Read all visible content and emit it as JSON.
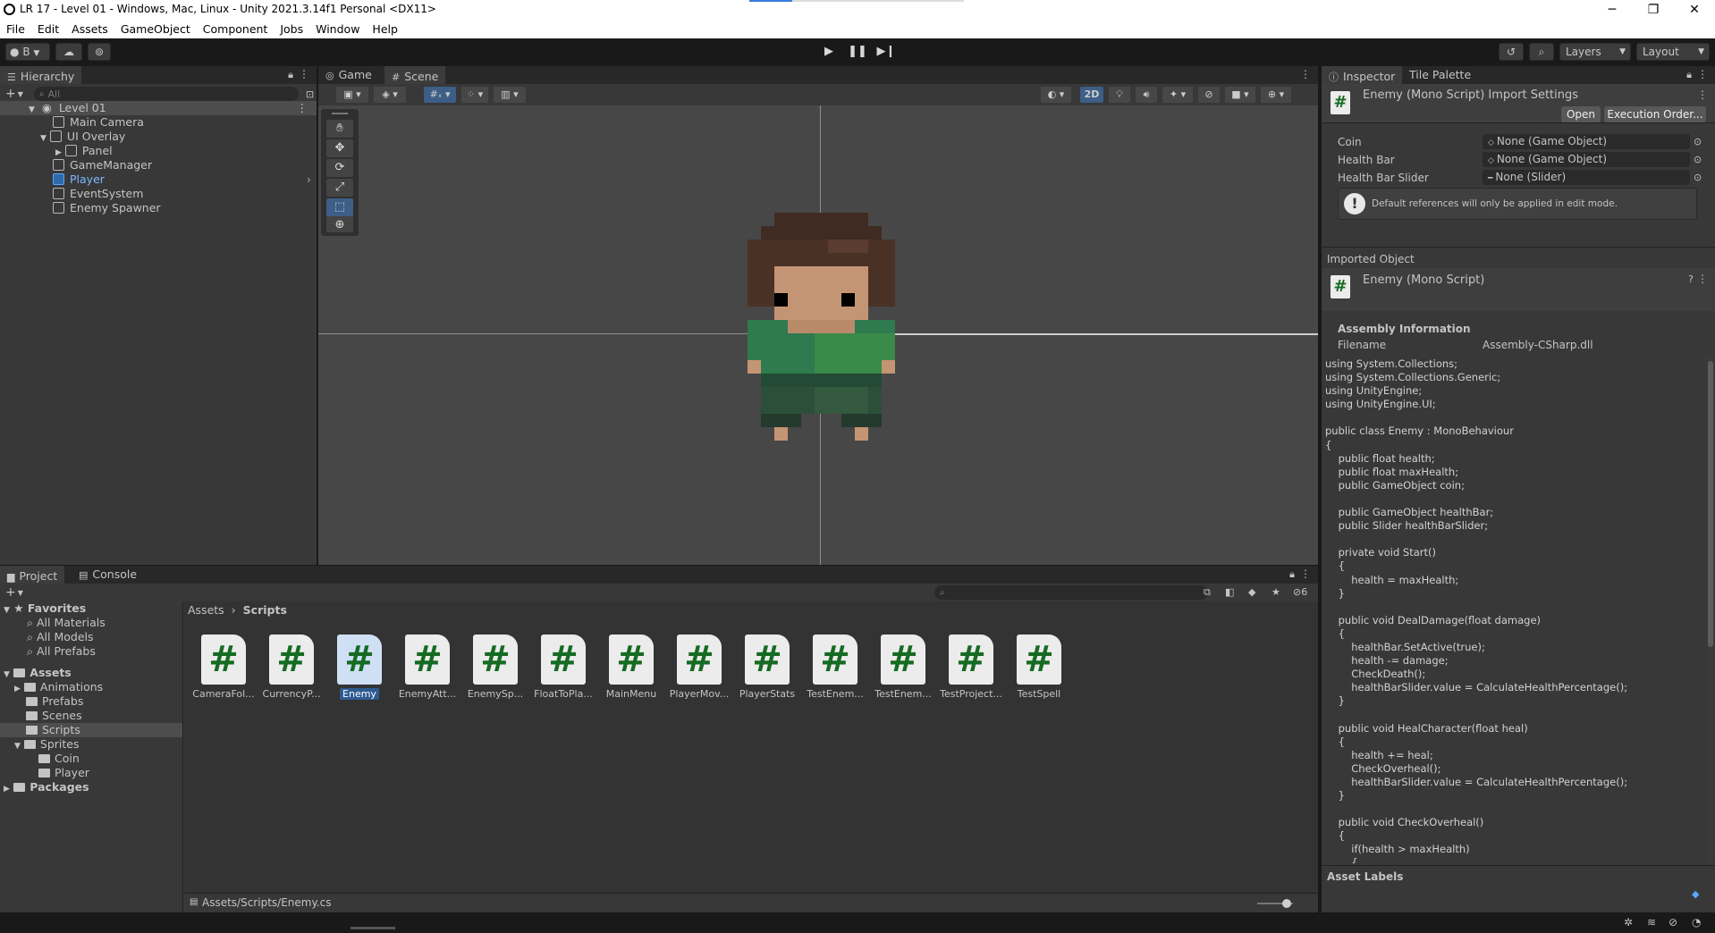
{
  "window": {
    "title": "LR 17 - Level 01 - Windows, Mac, Linux - Unity 2021.3.14f1 Personal <DX11>",
    "controls": [
      "─",
      "❐",
      "✕"
    ]
  },
  "menu": [
    "File",
    "Edit",
    "Assets",
    "GameObject",
    "Component",
    "Jobs",
    "Window",
    "Help"
  ],
  "toolbar": {
    "account_label": "B",
    "layers_label": "Layers",
    "layout_label": "Layout"
  },
  "hierarchy": {
    "tab": "Hierarchy",
    "search_placeholder": "All",
    "items": [
      {
        "label": "Level 01",
        "depth": 0,
        "kind": "scene"
      },
      {
        "label": "Main Camera",
        "depth": 1,
        "kind": "object"
      },
      {
        "label": "UI Overlay",
        "depth": 1,
        "kind": "object"
      },
      {
        "label": "Panel",
        "depth": 2,
        "kind": "object"
      },
      {
        "label": "GameManager",
        "depth": 1,
        "kind": "object"
      },
      {
        "label": "Player",
        "depth": 1,
        "kind": "prefab"
      },
      {
        "label": "EventSystem",
        "depth": 1,
        "kind": "object"
      },
      {
        "label": "Enemy Spawner",
        "depth": 1,
        "kind": "object"
      }
    ]
  },
  "scene": {
    "tabs": [
      "Game",
      "Scene"
    ],
    "mode_2d": "2D"
  },
  "project": {
    "tabs": [
      "Project",
      "Console"
    ],
    "favorites_label": "Favorites",
    "favorites": [
      "All Materials",
      "All Models",
      "All Prefabs"
    ],
    "assets_label": "Assets",
    "folders": [
      "Animations",
      "Prefabs",
      "Scenes",
      "Scripts",
      "Sprites"
    ],
    "sprite_folders": [
      "Coin",
      "Player"
    ],
    "packages_label": "Packages",
    "breadcrumb": [
      "Assets",
      "Scripts"
    ],
    "hidden_count": "6",
    "scripts": [
      "CameraFol...",
      "CurrencyP...",
      "Enemy",
      "EnemyAtt...",
      "EnemySp...",
      "FloatToPla...",
      "MainMenu",
      "PlayerMov...",
      "PlayerStats",
      "TestEnem...",
      "TestEnem...",
      "TestProject...",
      "TestSpell"
    ],
    "selected_path": "Assets/Scripts/Enemy.cs"
  },
  "inspector": {
    "tabs": [
      "Inspector",
      "Tile Palette"
    ],
    "header_title": "Enemy (Mono Script) Import Settings",
    "open_button": "Open",
    "exec_order_button": "Execution Order...",
    "fields": [
      {
        "label": "Coin",
        "value": "None (Game Object)"
      },
      {
        "label": "Health Bar",
        "value": "None (Game Object)"
      },
      {
        "label": "Health Bar Slider",
        "value": "None (Slider)"
      }
    ],
    "help_text": "Default references will only be applied in edit mode.",
    "imported_object_label": "Imported Object",
    "imported_object_title": "Enemy (Mono Script)",
    "assembly_info_label": "Assembly Information",
    "filename_label": "Filename",
    "filename_value": "Assembly-CSharp.dll",
    "code": "using System.Collections;\nusing System.Collections.Generic;\nusing UnityEngine;\nusing UnityEngine.UI;\n\npublic class Enemy : MonoBehaviour\n{\n    public float health;\n    public float maxHealth;\n    public GameObject coin;\n\n    public GameObject healthBar;\n    public Slider healthBarSlider;\n\n    private void Start()\n    {\n        health = maxHealth;\n    }\n\n    public void DealDamage(float damage)\n    {\n        healthBar.SetActive(true);\n        health -= damage;\n        CheckDeath();\n        healthBarSlider.value = CalculateHealthPercentage();\n    }\n\n    public void HealCharacter(float heal)\n    {\n        health += heal;\n        CheckOverheal();\n        healthBarSlider.value = CalculateHealthPercentage();\n    }\n\n    public void CheckOverheal()\n    {\n        if(health > maxHealth)\n        {",
    "asset_labels": "Asset Labels"
  }
}
